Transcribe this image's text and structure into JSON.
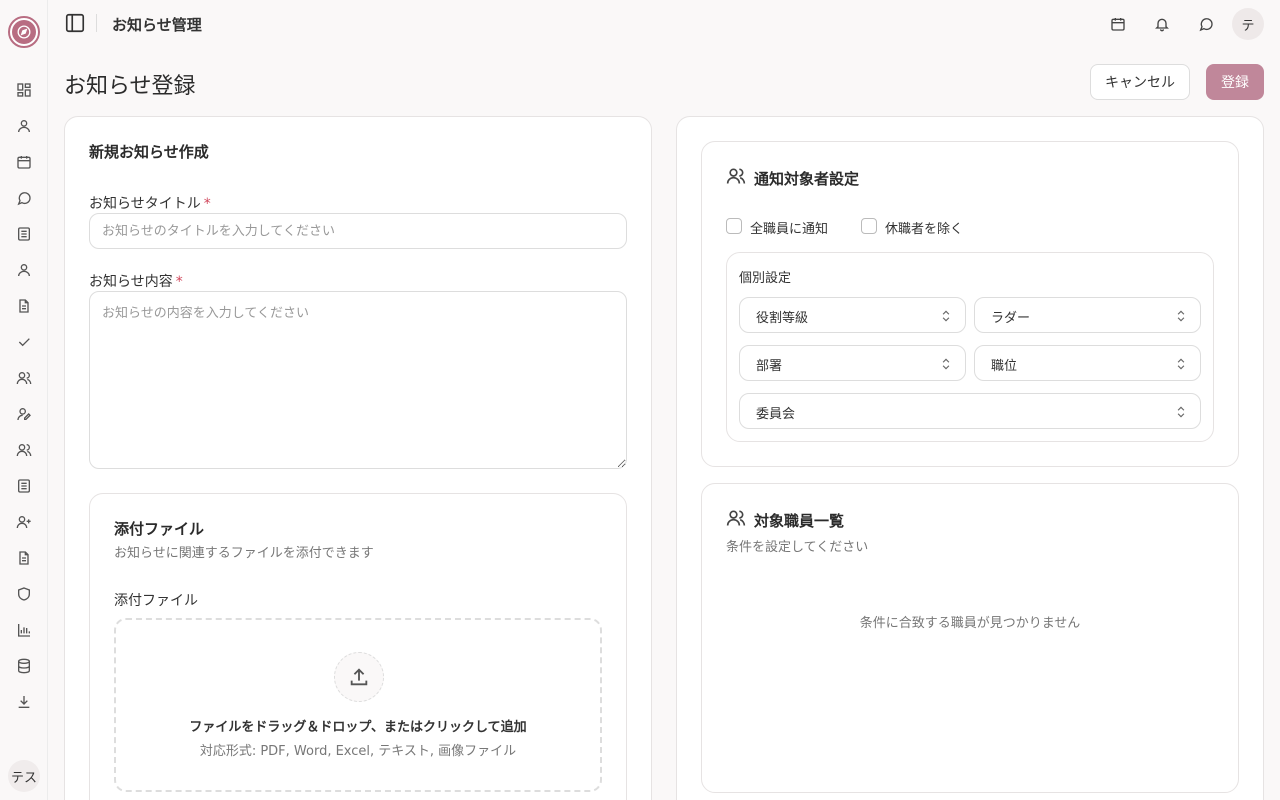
{
  "topbar": {
    "title": "お知らせ管理",
    "avatar": "テ"
  },
  "sidebar": {
    "user_avatar": "テス",
    "icons": [
      "dashboard-icon",
      "user-icon",
      "calendar-icon",
      "chat-icon",
      "list-icon",
      "user-icon",
      "document-icon",
      "check-icon",
      "users-icon",
      "user-edit-icon",
      "users-icon",
      "list-icon",
      "user-add-icon",
      "document-icon",
      "shield-icon",
      "bar-chart-icon",
      "database-icon",
      "download-icon"
    ]
  },
  "page": {
    "title": "お知らせ登録",
    "cancel_label": "キャンセル",
    "submit_label": "登録"
  },
  "form": {
    "heading": "新規お知らせ作成",
    "title_label": "お知らせタイトル",
    "title_placeholder": "お知らせのタイトルを入力してください",
    "content_label": "お知らせ内容",
    "content_placeholder": "お知らせの内容を入力してください",
    "required_mark": "*"
  },
  "attachments": {
    "heading": "添付ファイル",
    "description": "お知らせに関連するファイルを添付できます",
    "field_label": "添付ファイル",
    "dropzone_text": "ファイルをドラッグ＆ドロップ、またはクリックして追加",
    "dropzone_formats": "対応形式: PDF, Word, Excel, テキスト, 画像ファイル"
  },
  "target_settings": {
    "heading": "通知対象者設定",
    "notify_all_label": "全職員に通知",
    "exclude_leave_label": "休職者を除く",
    "individual_label": "個別設定",
    "selects": {
      "role_grade": "役割等級",
      "ladder": "ラダー",
      "department": "部署",
      "position": "職位",
      "committee": "委員会"
    }
  },
  "target_list": {
    "heading": "対象職員一覧",
    "subtitle": "条件を設定してください",
    "empty_message": "条件に合致する職員が見つかりません"
  }
}
